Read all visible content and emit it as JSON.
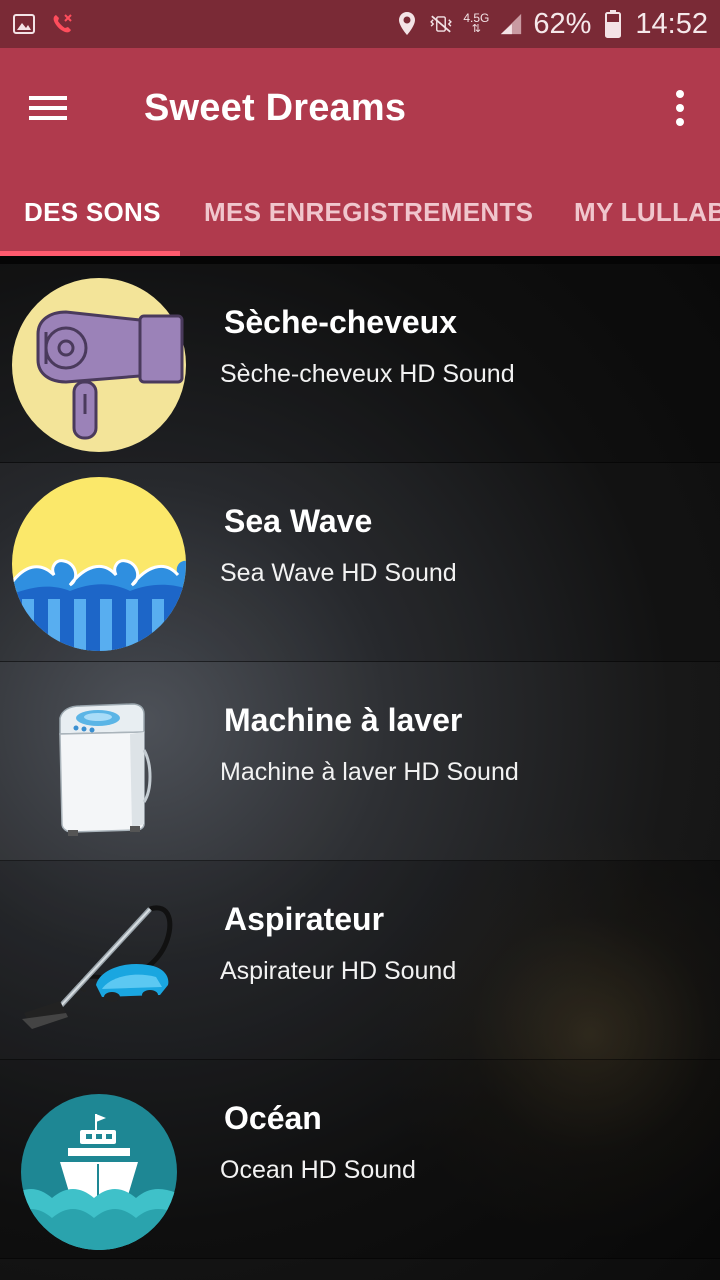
{
  "status_bar": {
    "battery_percent": "62%",
    "time": "14:52",
    "network_label": "4.5G",
    "icons": [
      "gallery-icon",
      "missed-call-icon",
      "location-icon",
      "vibrate-mute-icon",
      "network-4g-icon",
      "signal-icon",
      "battery-icon"
    ]
  },
  "app_bar": {
    "title": "Sweet Dreams",
    "menu_icon": "hamburger-menu-icon",
    "overflow_icon": "more-vert-icon"
  },
  "tabs": [
    {
      "label": "DES SONS",
      "active": true
    },
    {
      "label": "MES ENREGISTREMENTS",
      "active": false
    },
    {
      "label": "MY LULLAB",
      "active": false
    }
  ],
  "colors": {
    "app_bar": "#b03a4d",
    "status_bar": "#7a2a36",
    "tab_indicator": "#ff5a6e"
  },
  "sounds": [
    {
      "title": "Sèche-cheveux",
      "subtitle": "Sèche-cheveux HD Sound",
      "icon": "hair-dryer-icon"
    },
    {
      "title": "Sea Wave",
      "subtitle": "Sea Wave HD Sound",
      "icon": "sea-wave-icon"
    },
    {
      "title": "Machine à laver",
      "subtitle": "Machine à laver HD Sound",
      "icon": "washing-machine-icon"
    },
    {
      "title": "Aspirateur",
      "subtitle": "Aspirateur HD Sound",
      "icon": "vacuum-cleaner-icon"
    },
    {
      "title": "Océan",
      "subtitle": "Ocean HD Sound",
      "icon": "ship-ocean-icon"
    }
  ]
}
